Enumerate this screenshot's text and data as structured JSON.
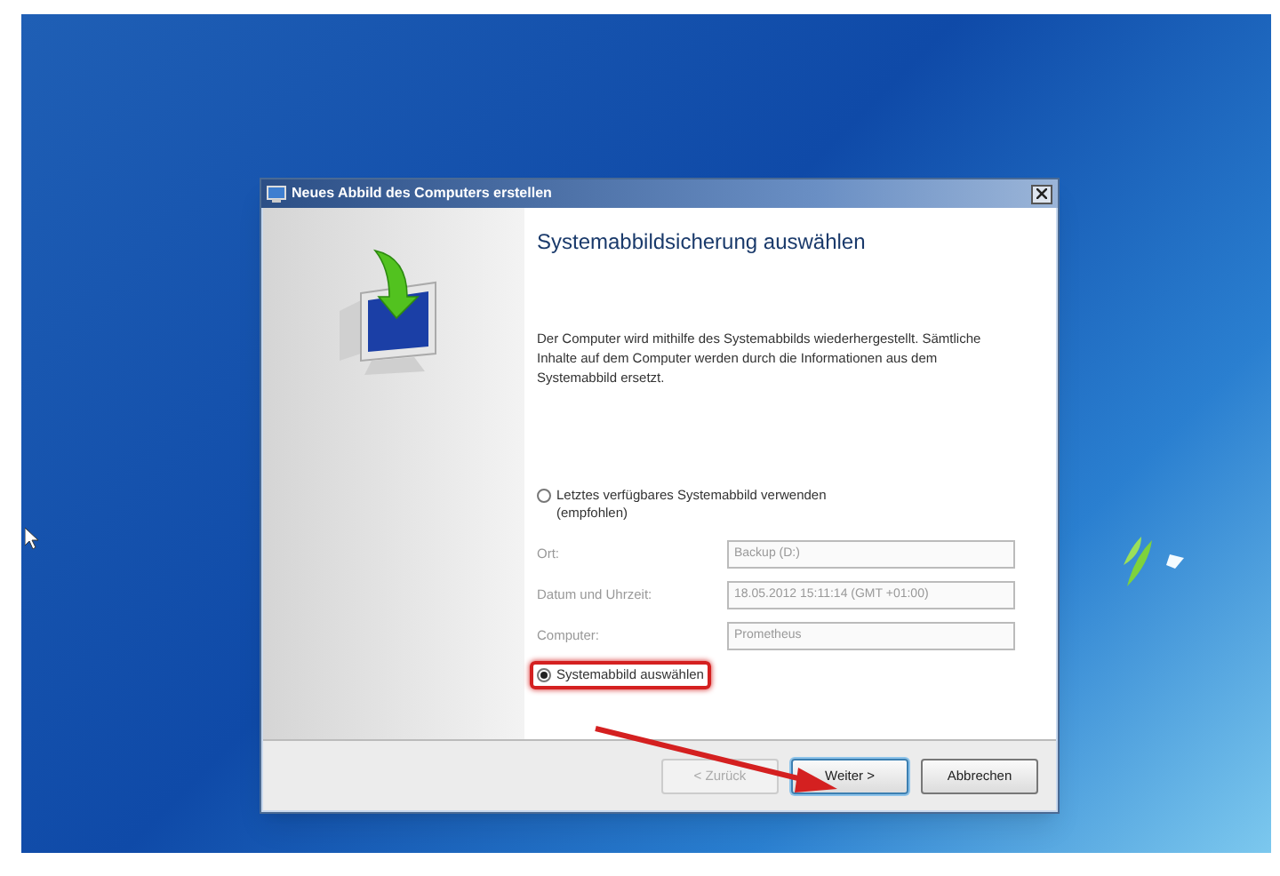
{
  "window": {
    "title": "Neues Abbild des Computers erstellen"
  },
  "heading": "Systemabbildsicherung auswählen",
  "description": "Der Computer wird mithilfe des Systemabbilds wiederhergestellt. Sämtliche Inhalte auf dem Computer werden durch die Informationen aus dem Systemabbild ersetzt.",
  "options": [
    {
      "label": "Letztes verfügbares Systemabbild verwenden (empfohlen)",
      "checked": false,
      "highlighted": false,
      "fields": [
        {
          "label": "Ort:",
          "value": "Backup (D:)",
          "disabled": true
        },
        {
          "label": "Datum und Uhrzeit:",
          "value": "18.05.2012 15:11:14 (GMT +01:00)",
          "disabled": true
        },
        {
          "label": "Computer:",
          "value": "Prometheus",
          "disabled": true
        }
      ]
    },
    {
      "label": "Systemabbild auswählen",
      "checked": true,
      "highlighted": true
    }
  ],
  "buttons": [
    {
      "label": "< Zurück",
      "disabled": true,
      "selected": false
    },
    {
      "label": "Weiter >",
      "disabled": false,
      "selected": true
    },
    {
      "label": "Abbrechen",
      "disabled": false,
      "selected": false
    }
  ]
}
